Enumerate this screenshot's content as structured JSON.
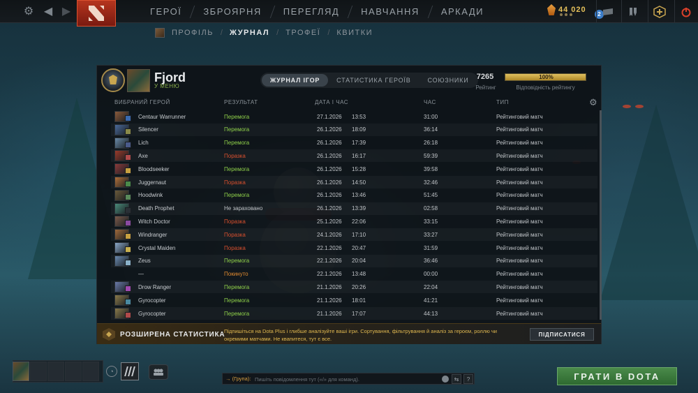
{
  "topbar": {
    "nav": [
      "ГЕРОЇ",
      "ЗБРОЯРНЯ",
      "ПЕРЕГЛЯД",
      "НАВЧАННЯ",
      "АРКАДИ"
    ],
    "currency_value": "44 020",
    "notification_count": "2"
  },
  "subnav": {
    "items": [
      "ПРОФІЛЬ",
      "ЖУРНАЛ",
      "ТРОФЕЇ",
      "КВИТКИ"
    ],
    "active": "ЖУРНАЛ"
  },
  "profile": {
    "name": "Fjord",
    "status": "У МЕНЮ"
  },
  "tabs": [
    "ЖУРНАЛ ІГОР",
    "СТАТИСТИКА ГЕРОЇВ",
    "СОЮЗНИКИ"
  ],
  "rating": {
    "value": "7265",
    "label": "Рейтинг",
    "confidence": "100%",
    "confidence_fraction": 1.0,
    "confidence_label": "Відповідність рейтингу"
  },
  "table": {
    "headers": {
      "hero": "ВИБРАНИЙ ГЕРОЙ",
      "result": "РЕЗУЛЬТАТ",
      "date": "ДАТА І ЧАС",
      "duration": "ЧАС",
      "type": "ТИП"
    },
    "rows": [
      {
        "hero": "Centaur Warrunner",
        "result": "Перемога",
        "result_kind": "win",
        "date": "27.1.2026",
        "time": "13:53",
        "duration": "31:00",
        "type": "Рейтинговий матч",
        "hero_color": "#8a5a3a",
        "item_color": "#3a6ab0"
      },
      {
        "hero": "Silencer",
        "result": "Перемога",
        "result_kind": "win",
        "date": "26.1.2026",
        "time": "18:09",
        "duration": "36:14",
        "type": "Рейтинговий матч",
        "hero_color": "#4a6a9a",
        "item_color": "#8a8a4a"
      },
      {
        "hero": "Lich",
        "result": "Перемога",
        "result_kind": "win",
        "date": "26.1.2026",
        "time": "17:39",
        "duration": "26:18",
        "type": "Рейтинговий матч",
        "hero_color": "#6a8aa8",
        "item_color": "#4a5a8a"
      },
      {
        "hero": "Axe",
        "result": "Поразка",
        "result_kind": "loss",
        "date": "26.1.2026",
        "time": "16:17",
        "duration": "59:39",
        "type": "Рейтинговий матч",
        "hero_color": "#9a3a2a",
        "item_color": "#b04a4a"
      },
      {
        "hero": "Bloodseeker",
        "result": "Перемога",
        "result_kind": "win",
        "date": "26.1.2026",
        "time": "15:28",
        "duration": "39:58",
        "type": "Рейтинговий матч",
        "hero_color": "#8a3a3a",
        "item_color": "#c8a040"
      },
      {
        "hero": "Juggernaut",
        "result": "Поразка",
        "result_kind": "loss",
        "date": "26.1.2026",
        "time": "14:50",
        "duration": "32:46",
        "type": "Рейтинговий матч",
        "hero_color": "#b0703a",
        "item_color": "#4a8a4a"
      },
      {
        "hero": "Hoodwink",
        "result": "Перемога",
        "result_kind": "win",
        "date": "26.1.2026",
        "time": "13:46",
        "duration": "51:45",
        "type": "Рейтинговий матч",
        "hero_color": "#6a5a3a",
        "item_color": "#5a8a5a"
      },
      {
        "hero": "Death Prophet",
        "result": "Не зараховано",
        "result_kind": "none",
        "date": "26.1.2026",
        "time": "13:39",
        "duration": "02:58",
        "type": "Рейтинговий матч",
        "hero_color": "#4a8a7a",
        "item_color": "#2a3036"
      },
      {
        "hero": "Witch Doctor",
        "result": "Поразка",
        "result_kind": "loss",
        "date": "25.1.2026",
        "time": "22:06",
        "duration": "33:15",
        "type": "Рейтинговий матч",
        "hero_color": "#7a5a4a",
        "item_color": "#8a4aa0"
      },
      {
        "hero": "Windranger",
        "result": "Поразка",
        "result_kind": "loss",
        "date": "24.1.2026",
        "time": "17:10",
        "duration": "33:27",
        "type": "Рейтинговий матч",
        "hero_color": "#a06a3a",
        "item_color": "#c8a040"
      },
      {
        "hero": "Crystal Maiden",
        "result": "Поразка",
        "result_kind": "loss",
        "date": "22.1.2026",
        "time": "20:47",
        "duration": "31:59",
        "type": "Рейтинговий матч",
        "hero_color": "#8aa8c8",
        "item_color": "#c8b050"
      },
      {
        "hero": "Zeus",
        "result": "Перемога",
        "result_kind": "win",
        "date": "22.1.2026",
        "time": "20:04",
        "duration": "36:46",
        "type": "Рейтинговий матч",
        "hero_color": "#6a8ab0",
        "item_color": "#8ab0c8"
      },
      {
        "hero": "—",
        "result": "Покинуто",
        "result_kind": "abandon",
        "date": "22.1.2026",
        "time": "13:48",
        "duration": "00:00",
        "type": "Рейтинговий матч",
        "hero_color": "",
        "item_color": ""
      },
      {
        "hero": "Drow Ranger",
        "result": "Перемога",
        "result_kind": "win",
        "date": "21.1.2026",
        "time": "20:26",
        "duration": "22:04",
        "type": "Рейтинговий матч",
        "hero_color": "#6a7aa8",
        "item_color": "#a04ab0"
      },
      {
        "hero": "Gyrocopter",
        "result": "Перемога",
        "result_kind": "win",
        "date": "21.1.2026",
        "time": "18:01",
        "duration": "41:21",
        "type": "Рейтинговий матч",
        "hero_color": "#8a7a4a",
        "item_color": "#4a8aa0"
      },
      {
        "hero": "Gyrocopter",
        "result": "Перемога",
        "result_kind": "win",
        "date": "21.1.2026",
        "time": "17:07",
        "duration": "44:13",
        "type": "Рейтинговий матч",
        "hero_color": "#8a7a4a",
        "item_color": "#b04a4a"
      }
    ]
  },
  "dota_plus": {
    "title": "РОЗШИРЕНА СТАТИСТИКА",
    "description": "Підпишіться на Dota Plus і глибше аналізуйте ваші ігри. Сортування, фільтрування й аналіз за героєм, роллю чи окремими матчами. Не квапитеся, тут є все.",
    "subscribe_label": "ПІДПИСАТИСЯ"
  },
  "chat": {
    "channel": "→ (Група):",
    "placeholder": "Пишіть повідомлення тут («/» для команд)."
  },
  "play_button": "ГРАТИ В DOTA",
  "colors": {
    "win": "#8fd04a",
    "loss": "#d9502e",
    "abandon": "#e08a30",
    "accent_gold": "#e0b850",
    "play_green": "#3e7a40"
  }
}
